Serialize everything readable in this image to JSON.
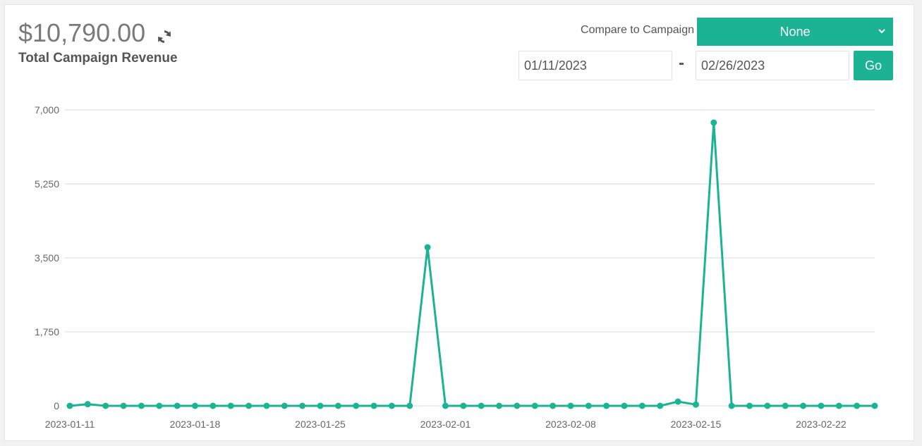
{
  "header": {
    "total_revenue": "$10,790.00",
    "revenue_label": "Total Campaign Revenue",
    "refresh_icon": "refresh-icon"
  },
  "controls": {
    "compare_label": "Compare to Campaign",
    "compare_selected": "None",
    "date_start": "01/11/2023",
    "date_separator": "-",
    "date_end": "02/26/2023",
    "go_label": "Go"
  },
  "colors": {
    "accent": "#1bb394",
    "grid": "#d9d9d9",
    "text": "#555555"
  },
  "chart_data": {
    "type": "line",
    "title": "",
    "xlabel": "",
    "ylabel": "",
    "ylim": [
      0,
      7000
    ],
    "yticks": [
      0,
      1750,
      3500,
      5250,
      7000
    ],
    "ytick_labels": [
      "0",
      "1,750",
      "3,500",
      "5,250",
      "7,000"
    ],
    "x_range": [
      "2023-01-11",
      "2023-02-26"
    ],
    "xtick_labels": [
      "2023-01-11",
      "2023-01-18",
      "2023-01-25",
      "2023-02-01",
      "2023-02-08",
      "2023-02-15",
      "2023-02-22"
    ],
    "grid": true,
    "legend": "none",
    "x": [
      "2023-01-11",
      "2023-01-12",
      "2023-01-13",
      "2023-01-14",
      "2023-01-15",
      "2023-01-16",
      "2023-01-17",
      "2023-01-18",
      "2023-01-19",
      "2023-01-20",
      "2023-01-21",
      "2023-01-22",
      "2023-01-23",
      "2023-01-24",
      "2023-01-25",
      "2023-01-26",
      "2023-01-27",
      "2023-01-28",
      "2023-01-29",
      "2023-01-30",
      "2023-01-31",
      "2023-02-01",
      "2023-02-02",
      "2023-02-03",
      "2023-02-04",
      "2023-02-05",
      "2023-02-06",
      "2023-02-07",
      "2023-02-08",
      "2023-02-09",
      "2023-02-10",
      "2023-02-11",
      "2023-02-12",
      "2023-02-13",
      "2023-02-14",
      "2023-02-15",
      "2023-02-16",
      "2023-02-17",
      "2023-02-18",
      "2023-02-19",
      "2023-02-20",
      "2023-02-21",
      "2023-02-22",
      "2023-02-23",
      "2023-02-24",
      "2023-02-25"
    ],
    "values": [
      0,
      40,
      0,
      0,
      0,
      0,
      0,
      0,
      0,
      0,
      0,
      0,
      0,
      0,
      0,
      0,
      0,
      0,
      0,
      0,
      3750,
      0,
      0,
      0,
      0,
      0,
      0,
      0,
      0,
      0,
      0,
      0,
      0,
      0,
      100,
      30,
      6700,
      0,
      0,
      0,
      0,
      0,
      0,
      0,
      0,
      0
    ]
  }
}
